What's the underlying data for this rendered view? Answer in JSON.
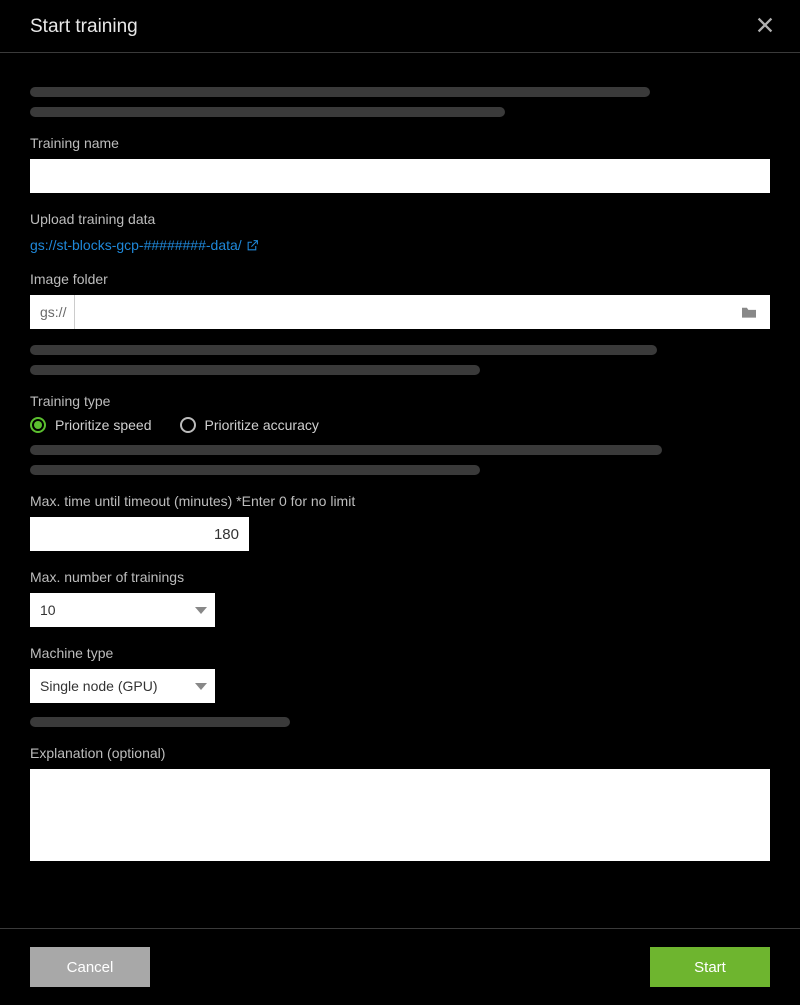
{
  "dialog": {
    "title": "Start training"
  },
  "fields": {
    "training_name_label": "Training name",
    "training_name_value": "",
    "upload_label": "Upload training data",
    "upload_link": "gs://st-blocks-gcp-########-data/",
    "image_folder_label": "Image folder",
    "image_folder_prefix": "gs://",
    "image_folder_value": "",
    "training_type_label": "Training type",
    "training_type_options": {
      "speed": "Prioritize speed",
      "accuracy": "Prioritize accuracy"
    },
    "training_type_selected": "speed",
    "timeout_label": "Max. time until timeout (minutes) *Enter 0 for no limit",
    "timeout_value": "180",
    "max_trainings_label": "Max. number of trainings",
    "max_trainings_value": "10",
    "machine_type_label": "Machine type",
    "machine_type_value": "Single node (GPU)",
    "explanation_label": "Explanation (optional)",
    "explanation_value": ""
  },
  "footer": {
    "cancel": "Cancel",
    "start": "Start"
  }
}
